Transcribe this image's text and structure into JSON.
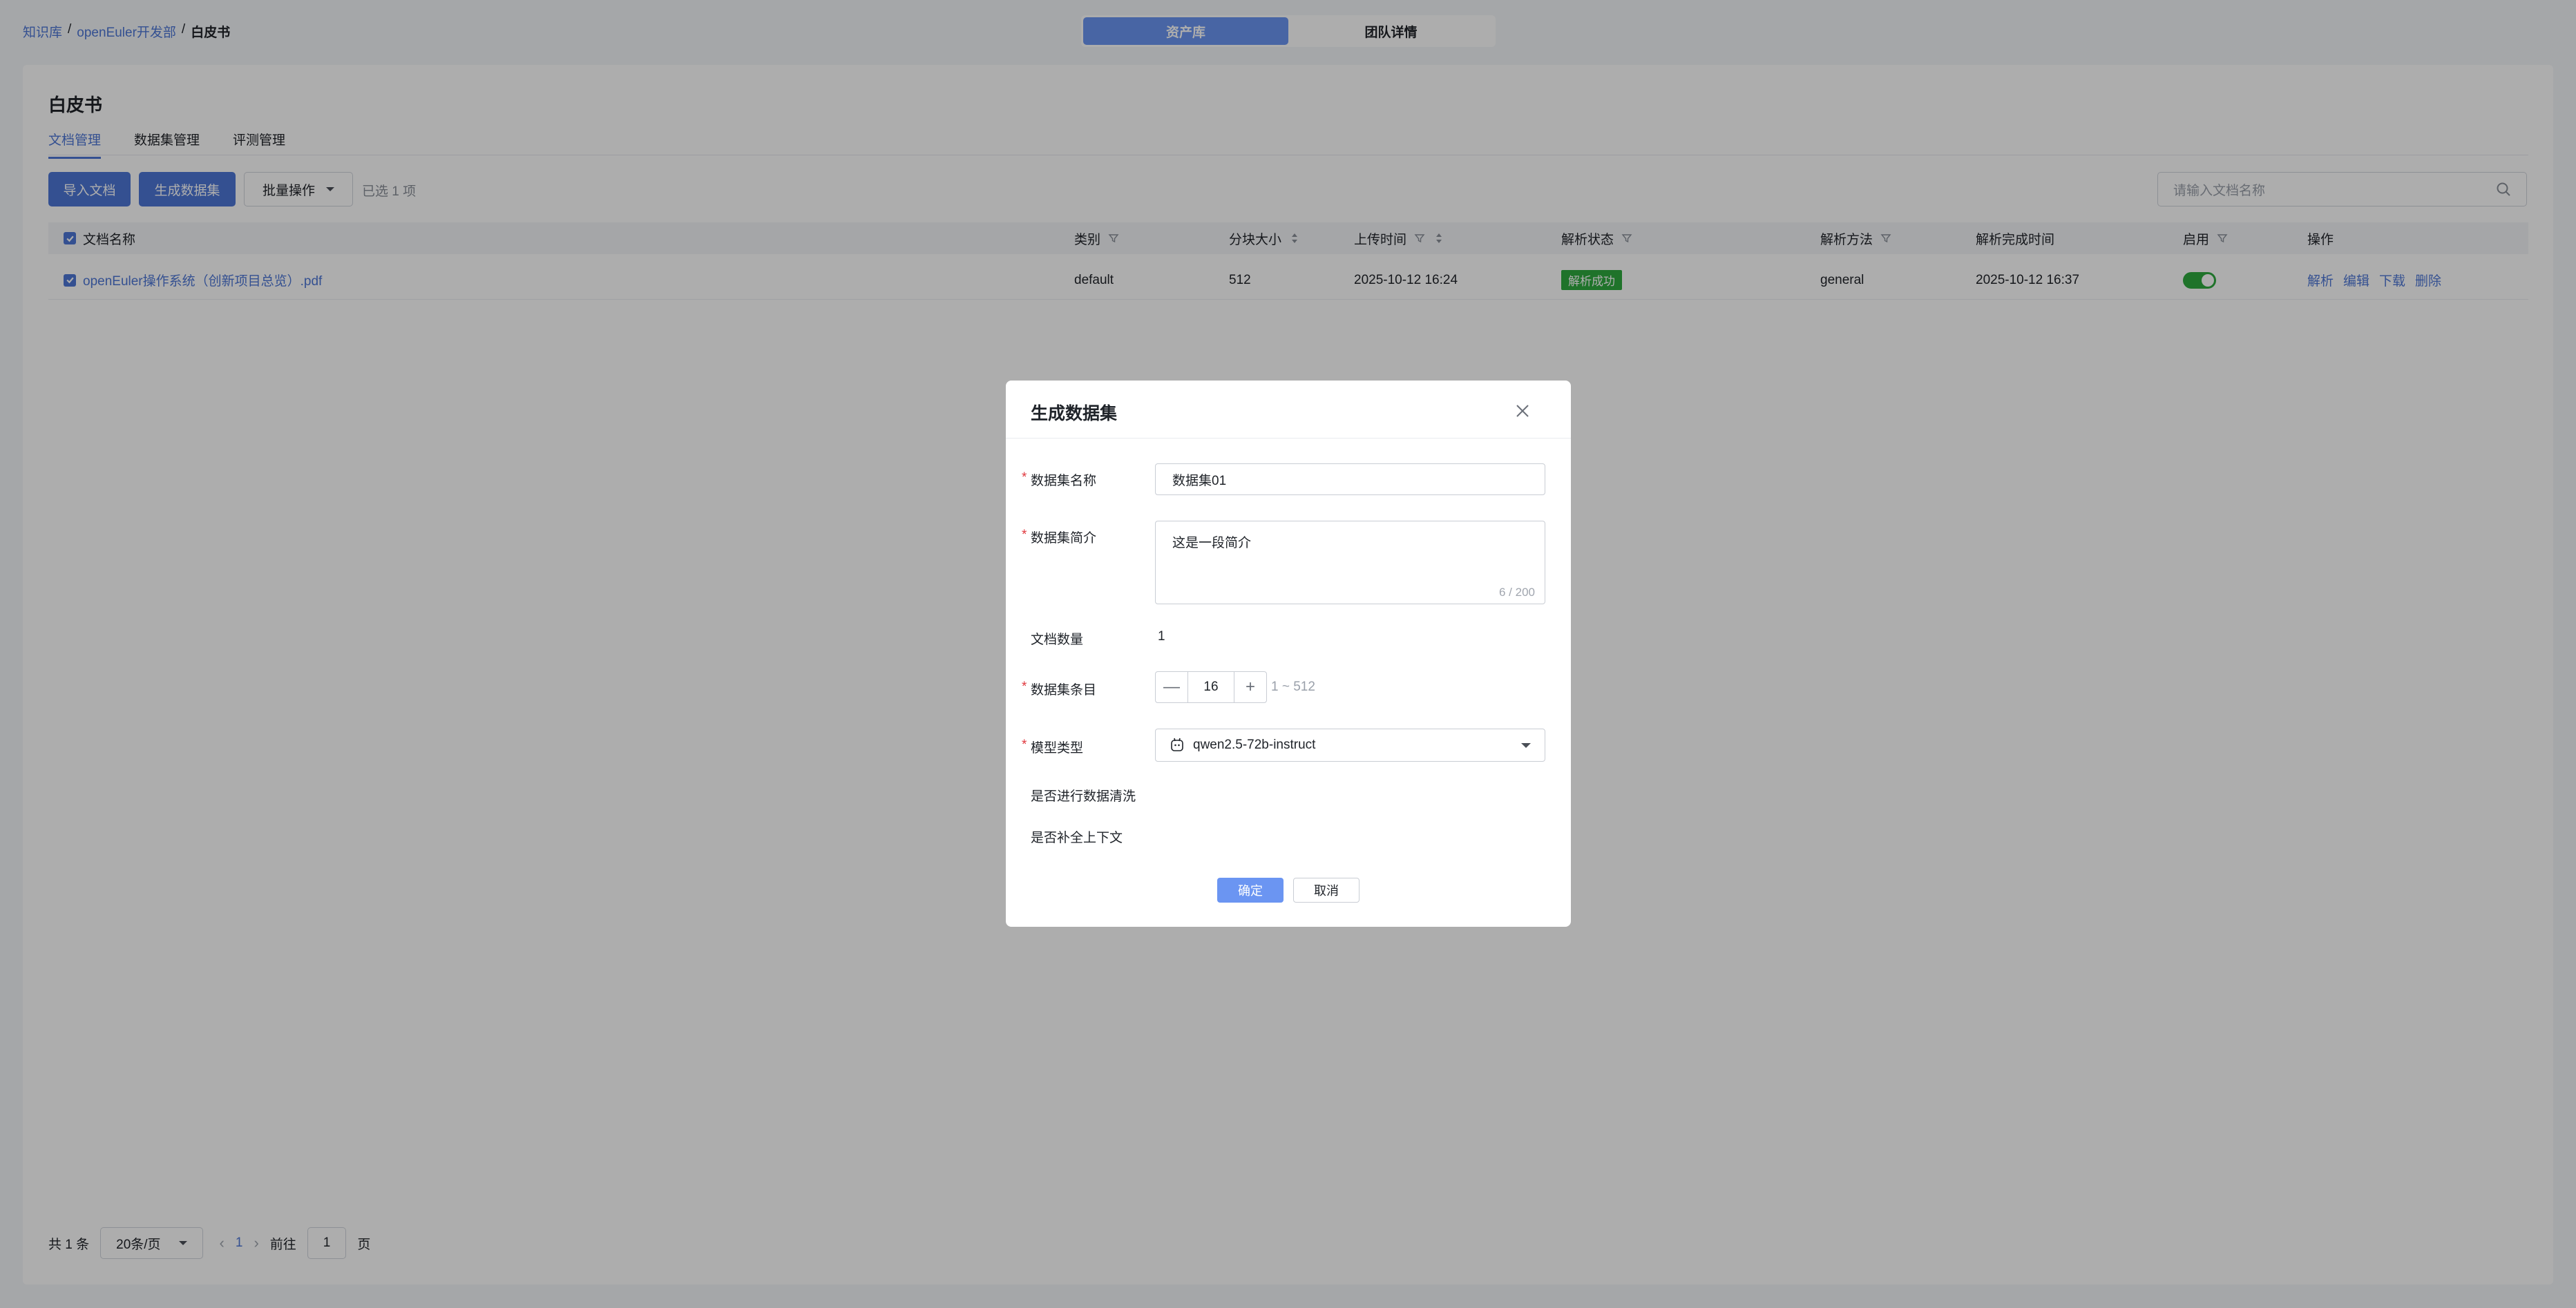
{
  "breadcrumb": {
    "root": "知识库",
    "team": "openEuler开发部",
    "current": "白皮书",
    "sep": "/"
  },
  "top_tabs": {
    "asset_library": "资产库",
    "team_detail": "团队详情"
  },
  "page": {
    "title": "白皮书"
  },
  "tabs": [
    "文档管理",
    "数据集管理",
    "评测管理"
  ],
  "toolbar": {
    "import_label": "导入文档",
    "generate_label": "生成数据集",
    "batch_label": "批量操作",
    "selected_text": "已选 1 项",
    "search_placeholder": "请输入文档名称"
  },
  "table": {
    "headers": {
      "name": "文档名称",
      "category": "类别",
      "chunk_size": "分块大小",
      "upload_time": "上传时间",
      "parse_status": "解析状态",
      "parse_method": "解析方法",
      "finish_time": "解析完成时间",
      "enabled": "启用",
      "actions": "操作"
    },
    "rows": [
      {
        "name": "openEuler操作系统（创新项目总览）.pdf",
        "category": "default",
        "chunk_size": "512",
        "upload_time": "2025-10-12 16:24",
        "parse_status": "解析成功",
        "parse_method": "general",
        "finish_time": "2025-10-12 16:37",
        "enabled": true,
        "actions": [
          "解析",
          "编辑",
          "下载",
          "删除"
        ]
      }
    ]
  },
  "pagination": {
    "total": "共 1 条",
    "page_size": "20条/页",
    "current": "1",
    "goto": "前往",
    "goto_value": "1",
    "page_unit": "页"
  },
  "dialog": {
    "title": "生成数据集",
    "dataset_name_label": "数据集名称",
    "dataset_name_value": "数据集01",
    "dataset_desc_label": "数据集简介",
    "dataset_desc_value": "这是一段简介",
    "dataset_desc_count": "6 / 200",
    "doc_count_label": "文档数量",
    "doc_count_value": "1",
    "items_label": "数据集条目",
    "items_value": "16",
    "items_range": "1 ~ 512",
    "model_label": "模型类型",
    "model_value": "qwen2.5-72b-instruct",
    "clean_label": "是否进行数据清洗",
    "clean_enabled": true,
    "context_label": "是否补全上下文",
    "context_enabled": true,
    "confirm_label": "确定",
    "cancel_label": "取消"
  },
  "colors": {
    "primary": "#4d77d6",
    "success": "#2eaa3f",
    "required": "#e0383e"
  }
}
